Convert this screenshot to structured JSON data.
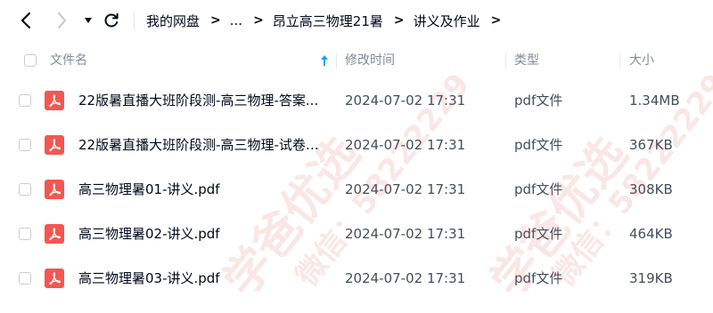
{
  "toolbar": {
    "back_icon": "chevron-left-icon",
    "forward_icon": "chevron-right-icon",
    "more_icon": "caret-down-icon",
    "refresh_icon": "refresh-icon"
  },
  "breadcrumb": {
    "items": [
      "我的网盘",
      "...",
      "昂立高三物理21暑",
      "讲义及作业"
    ]
  },
  "header": {
    "name": "文件名",
    "time": "修改时间",
    "type": "类型",
    "size": "大小",
    "sort_icon": "sort-ascending-icon"
  },
  "files": [
    {
      "name": "22版暑直播大班阶段测-高三物理-答案...",
      "time": "2024-07-02 17:31",
      "type": "pdf文件",
      "size": "1.34MB"
    },
    {
      "name": "22版暑直播大班阶段测-高三物理-试卷....",
      "time": "2024-07-02 17:31",
      "type": "pdf文件",
      "size": "367KB"
    },
    {
      "name": "高三物理暑01-讲义.pdf",
      "time": "2024-07-02 17:31",
      "type": "pdf文件",
      "size": "308KB"
    },
    {
      "name": "高三物理暑02-讲义.pdf",
      "time": "2024-07-02 17:31",
      "type": "pdf文件",
      "size": "464KB"
    },
    {
      "name": "高三物理暑03-讲义.pdf",
      "time": "2024-07-02 17:31",
      "type": "pdf文件",
      "size": "319KB"
    }
  ],
  "watermark": {
    "line1": "学爸优选",
    "line2": "微信：58222229"
  },
  "colors": {
    "pdf_red": "#f45652",
    "accent_blue": "#06a7ff",
    "header_text": "#818999"
  }
}
